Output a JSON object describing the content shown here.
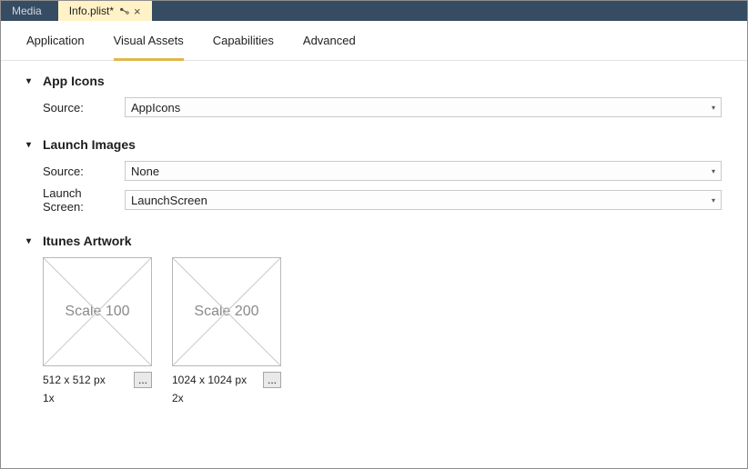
{
  "tabs": {
    "inactive": "Media",
    "active": "Info.plist*"
  },
  "subnav": {
    "items": [
      "Application",
      "Visual Assets",
      "Capabilities",
      "Advanced"
    ],
    "active_index": 1
  },
  "sections": {
    "appIcons": {
      "title": "App Icons",
      "sourceLabel": "Source:",
      "sourceValue": "AppIcons"
    },
    "launch": {
      "title": "Launch Images",
      "sourceLabel": "Source:",
      "sourceValue": "None",
      "screenLabel": "Launch Screen:",
      "screenValue": "LaunchScreen"
    },
    "itunes": {
      "title": "Itunes Artwork",
      "items": [
        {
          "placeholder": "Scale 100",
          "dim": "512 x 512 px",
          "scale": "1x",
          "more": "..."
        },
        {
          "placeholder": "Scale 200",
          "dim": "1024 x 1024 px",
          "scale": "2x",
          "more": "..."
        }
      ]
    }
  }
}
